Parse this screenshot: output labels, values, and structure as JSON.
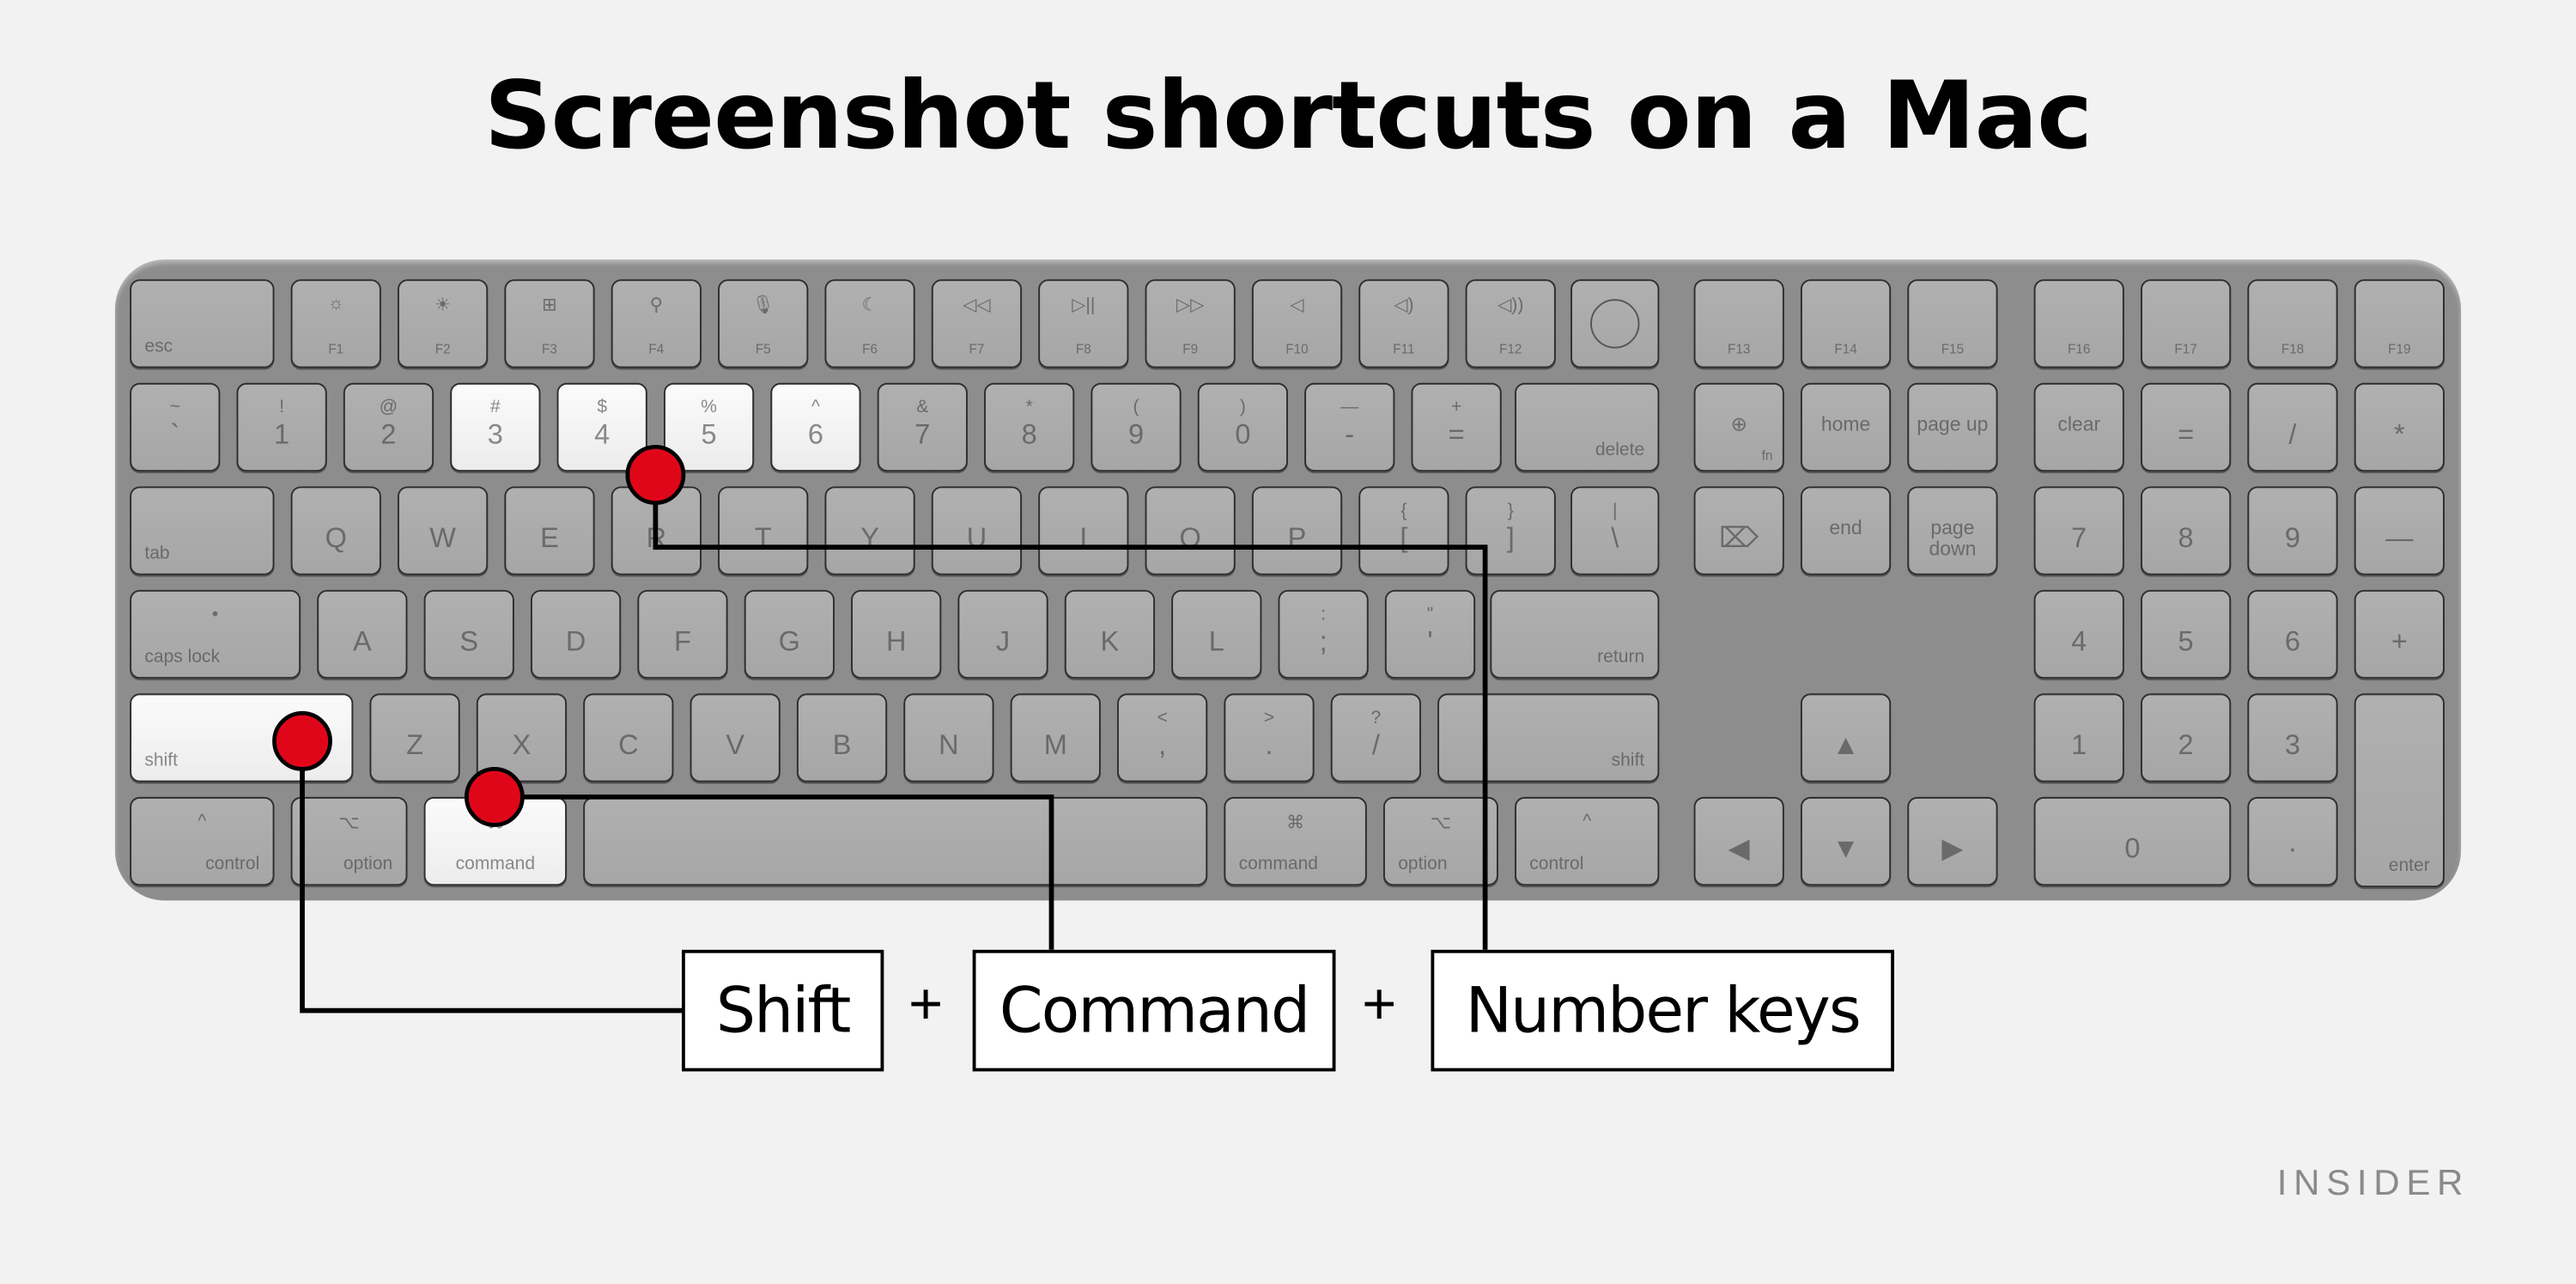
{
  "title": "Screenshot shortcuts on a Mac",
  "brand": "INSIDER",
  "colors": {
    "background": "#f2f2f2",
    "keyboard": "#8d8d8d",
    "key": "#aaaaaa",
    "highlight_key": "#f5f5f5",
    "marker": "#e0061a",
    "line": "#000000"
  },
  "shortcut": {
    "parts": [
      "Shift",
      "Command",
      "Number keys"
    ],
    "separator": "+"
  },
  "keyboard": {
    "rows": [
      [
        {
          "b": "esc"
        },
        {
          "t": "☼",
          "b": "F1",
          "icon": "brightness-down-icon"
        },
        {
          "t": "☀",
          "b": "F2",
          "icon": "brightness-up-icon"
        },
        {
          "t": "⊞",
          "b": "F3",
          "icon": "mission-control-icon"
        },
        {
          "t": "⚲",
          "b": "F4",
          "icon": "search-icon"
        },
        {
          "t": "🎙",
          "b": "F5",
          "icon": "microphone-icon"
        },
        {
          "t": "☾",
          "b": "F6",
          "icon": "moon-icon"
        },
        {
          "t": "◁◁",
          "b": "F7",
          "icon": "rewind-icon"
        },
        {
          "t": "▷||",
          "b": "F8",
          "icon": "play-pause-icon"
        },
        {
          "t": "▷▷",
          "b": "F9",
          "icon": "fast-forward-icon"
        },
        {
          "t": "◁",
          "b": "F10",
          "icon": "mute-icon"
        },
        {
          "t": "◁)",
          "b": "F11",
          "icon": "volume-down-icon"
        },
        {
          "t": "◁))",
          "b": "F12",
          "icon": "volume-up-icon"
        },
        {
          "icon": "touch-id-icon"
        },
        {
          "b": "F13"
        },
        {
          "b": "F14"
        },
        {
          "b": "F15"
        },
        {
          "b": "F16"
        },
        {
          "b": "F17"
        },
        {
          "b": "F18"
        },
        {
          "b": "F19"
        }
      ],
      [
        {
          "t": "~",
          "m": "`"
        },
        {
          "t": "!",
          "m": "1"
        },
        {
          "t": "@",
          "m": "2"
        },
        {
          "t": "#",
          "m": "3",
          "hl": true
        },
        {
          "t": "$",
          "m": "4",
          "hl": true
        },
        {
          "t": "%",
          "m": "5",
          "hl": true
        },
        {
          "t": "^",
          "m": "6",
          "hl": true
        },
        {
          "t": "&",
          "m": "7"
        },
        {
          "t": "*",
          "m": "8"
        },
        {
          "t": "(",
          "m": "9"
        },
        {
          "t": ")",
          "m": "0"
        },
        {
          "t": "—",
          "m": "-"
        },
        {
          "t": "+",
          "m": "="
        },
        {
          "b": "delete"
        },
        {
          "m": "⊕",
          "fn": "fn",
          "icon": "globe-icon"
        },
        {
          "m": "home"
        },
        {
          "m": "page up"
        },
        {
          "m": "clear"
        },
        {
          "m": "="
        },
        {
          "m": "/"
        },
        {
          "m": "*"
        }
      ],
      [
        {
          "b": "tab"
        },
        {
          "m": "Q"
        },
        {
          "m": "W"
        },
        {
          "m": "E"
        },
        {
          "m": "R"
        },
        {
          "m": "T"
        },
        {
          "m": "Y"
        },
        {
          "m": "U"
        },
        {
          "m": "I"
        },
        {
          "m": "O"
        },
        {
          "m": "P"
        },
        {
          "t": "{",
          "m": "["
        },
        {
          "t": "}",
          "m": "]"
        },
        {
          "t": "|",
          "m": "\\"
        },
        {
          "m": "⌦",
          "icon": "forward-delete-icon"
        },
        {
          "m": "end"
        },
        {
          "m": "page down"
        },
        {
          "m": "7"
        },
        {
          "m": "8"
        },
        {
          "m": "9"
        },
        {
          "m": "—"
        }
      ],
      [
        {
          "t": "•",
          "b": "caps lock"
        },
        {
          "m": "A"
        },
        {
          "m": "S"
        },
        {
          "m": "D"
        },
        {
          "m": "F"
        },
        {
          "m": "G"
        },
        {
          "m": "H"
        },
        {
          "m": "J"
        },
        {
          "m": "K"
        },
        {
          "m": "L"
        },
        {
          "t": ":",
          "m": ";"
        },
        {
          "t": "\"",
          "m": "'"
        },
        {
          "b": "return"
        },
        {
          "m": "4"
        },
        {
          "m": "5"
        },
        {
          "m": "6"
        },
        {
          "m": "+"
        }
      ],
      [
        {
          "b": "shift",
          "hl": true
        },
        {
          "m": "Z"
        },
        {
          "m": "X"
        },
        {
          "m": "C"
        },
        {
          "m": "V"
        },
        {
          "m": "B"
        },
        {
          "m": "N"
        },
        {
          "m": "M"
        },
        {
          "t": "<",
          "m": ","
        },
        {
          "t": ">",
          "m": "."
        },
        {
          "t": "?",
          "m": "/"
        },
        {
          "b": "shift"
        },
        {
          "m": "▲",
          "icon": "arrow-up-icon"
        },
        {
          "m": "1"
        },
        {
          "m": "2"
        },
        {
          "m": "3"
        },
        {
          "b": "enter"
        }
      ],
      [
        {
          "t": "^",
          "b": "control"
        },
        {
          "t": "⌥",
          "b": "option"
        },
        {
          "t": "⌘",
          "b": "command",
          "hl": true
        },
        {},
        {
          "t": "⌘",
          "b": "command"
        },
        {
          "t": "⌥",
          "b": "option"
        },
        {
          "t": "^",
          "b": "control"
        },
        {
          "m": "◀",
          "icon": "arrow-left-icon"
        },
        {
          "m": "▼",
          "icon": "arrow-down-icon"
        },
        {
          "m": "▶",
          "icon": "arrow-right-icon"
        },
        {
          "m": "0"
        },
        {
          "m": "·"
        }
      ]
    ]
  }
}
